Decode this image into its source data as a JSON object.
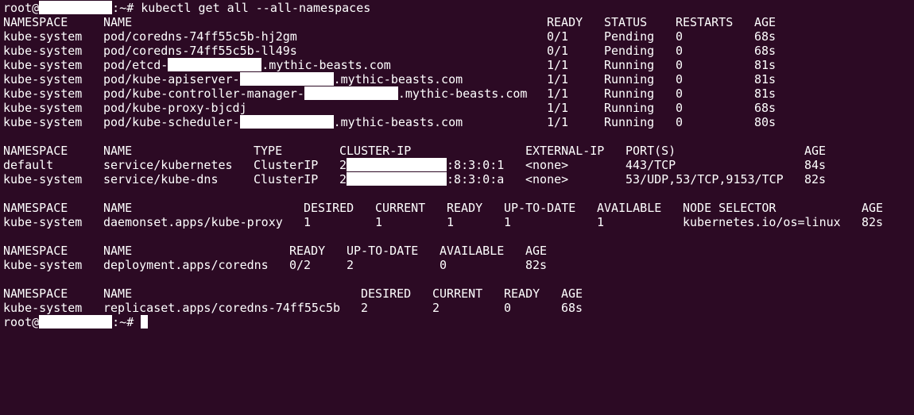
{
  "prompt": {
    "user": "root@",
    "suffix": ":~# "
  },
  "command": "kubectl get all --all-namespaces",
  "pods": {
    "headers": [
      "NAMESPACE",
      "NAME",
      "READY",
      "STATUS",
      "RESTARTS",
      "AGE"
    ],
    "rows": [
      {
        "ns": "kube-system",
        "name_pre": "pod/coredns-74ff55c5b-hj2gm",
        "name_post": "",
        "ready": "0/1",
        "status": "Pending",
        "restarts": "0",
        "age": "68s"
      },
      {
        "ns": "kube-system",
        "name_pre": "pod/coredns-74ff55c5b-ll49s",
        "name_post": "",
        "ready": "0/1",
        "status": "Pending",
        "restarts": "0",
        "age": "68s"
      },
      {
        "ns": "kube-system",
        "name_pre": "pod/etcd-",
        "name_post": ".mythic-beasts.com",
        "ready": "1/1",
        "status": "Running",
        "restarts": "0",
        "age": "81s"
      },
      {
        "ns": "kube-system",
        "name_pre": "pod/kube-apiserver-",
        "name_post": ".mythic-beasts.com",
        "ready": "1/1",
        "status": "Running",
        "restarts": "0",
        "age": "81s"
      },
      {
        "ns": "kube-system",
        "name_pre": "pod/kube-controller-manager-",
        "name_post": ".mythic-beasts.com",
        "ready": "1/1",
        "status": "Running",
        "restarts": "0",
        "age": "81s"
      },
      {
        "ns": "kube-system",
        "name_pre": "pod/kube-proxy-bjcdj",
        "name_post": "",
        "ready": "1/1",
        "status": "Running",
        "restarts": "0",
        "age": "68s"
      },
      {
        "ns": "kube-system",
        "name_pre": "pod/kube-scheduler-",
        "name_post": ".mythic-beasts.com",
        "ready": "1/1",
        "status": "Running",
        "restarts": "0",
        "age": "80s"
      }
    ]
  },
  "services": {
    "headers": [
      "NAMESPACE",
      "NAME",
      "TYPE",
      "CLUSTER-IP",
      "EXTERNAL-IP",
      "PORT(S)",
      "AGE"
    ],
    "rows": [
      {
        "ns": "default",
        "name": "service/kubernetes",
        "type": "ClusterIP",
        "ip_pre": "2",
        "ip_post": ":8:3:0:1",
        "external": "<none>",
        "ports": "443/TCP",
        "age": "84s"
      },
      {
        "ns": "kube-system",
        "name": "service/kube-dns",
        "type": "ClusterIP",
        "ip_pre": "2",
        "ip_post": ":8:3:0:a",
        "external": "<none>",
        "ports": "53/UDP,53/TCP,9153/TCP",
        "age": "82s"
      }
    ]
  },
  "daemonsets": {
    "headers": [
      "NAMESPACE",
      "NAME",
      "DESIRED",
      "CURRENT",
      "READY",
      "UP-TO-DATE",
      "AVAILABLE",
      "NODE SELECTOR",
      "AGE"
    ],
    "rows": [
      {
        "ns": "kube-system",
        "name": "daemonset.apps/kube-proxy",
        "desired": "1",
        "current": "1",
        "ready": "1",
        "uptodate": "1",
        "available": "1",
        "selector": "kubernetes.io/os=linux",
        "age": "82s"
      }
    ]
  },
  "deployments": {
    "headers": [
      "NAMESPACE",
      "NAME",
      "READY",
      "UP-TO-DATE",
      "AVAILABLE",
      "AGE"
    ],
    "rows": [
      {
        "ns": "kube-system",
        "name": "deployment.apps/coredns",
        "ready": "0/2",
        "uptodate": "2",
        "available": "0",
        "age": "82s"
      }
    ]
  },
  "replicasets": {
    "headers": [
      "NAMESPACE",
      "NAME",
      "DESIRED",
      "CURRENT",
      "READY",
      "AGE"
    ],
    "rows": [
      {
        "ns": "kube-system",
        "name": "replicaset.apps/coredns-74ff55c5b",
        "desired": "2",
        "current": "2",
        "ready": "0",
        "age": "68s"
      }
    ]
  }
}
